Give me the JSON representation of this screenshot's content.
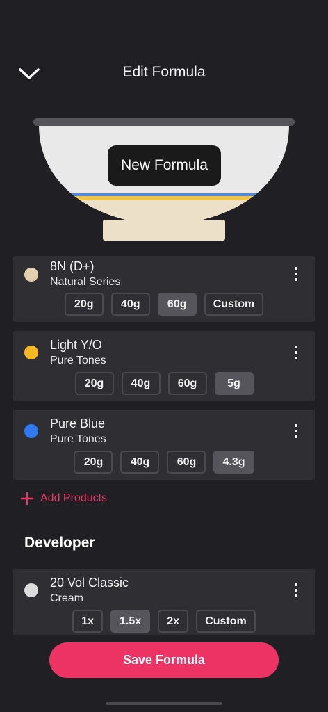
{
  "header": {
    "title": "Edit Formula",
    "back_icon": "chevron-down-icon"
  },
  "bowl": {
    "badge": "New Formula"
  },
  "products": [
    {
      "name": "8N (D+)",
      "series": "Natural Series",
      "color": "#e2d1b0",
      "options": [
        "20g",
        "40g",
        "60g",
        "Custom"
      ],
      "selected": "60g"
    },
    {
      "name": "Light Y/O",
      "series": "Pure Tones",
      "color": "#f6b822",
      "options": [
        "20g",
        "40g",
        "60g",
        "5g"
      ],
      "selected": "5g"
    },
    {
      "name": "Pure Blue",
      "series": "Pure Tones",
      "color": "#2f7af0",
      "options": [
        "20g",
        "40g",
        "60g",
        "4.3g"
      ],
      "selected": "4.3g"
    }
  ],
  "add_products": {
    "label": "Add Products",
    "icon": "plus-icon",
    "color": "#e33a67"
  },
  "developer": {
    "section_title": "Developer",
    "name": "20 Vol Classic",
    "series": "Cream",
    "color": "#dcdcdc",
    "options": [
      "1x",
      "1.5x",
      "2x",
      "Custom"
    ],
    "selected": "1.5x"
  },
  "save_button": {
    "label": "Save Formula",
    "color": "#ec3363"
  }
}
